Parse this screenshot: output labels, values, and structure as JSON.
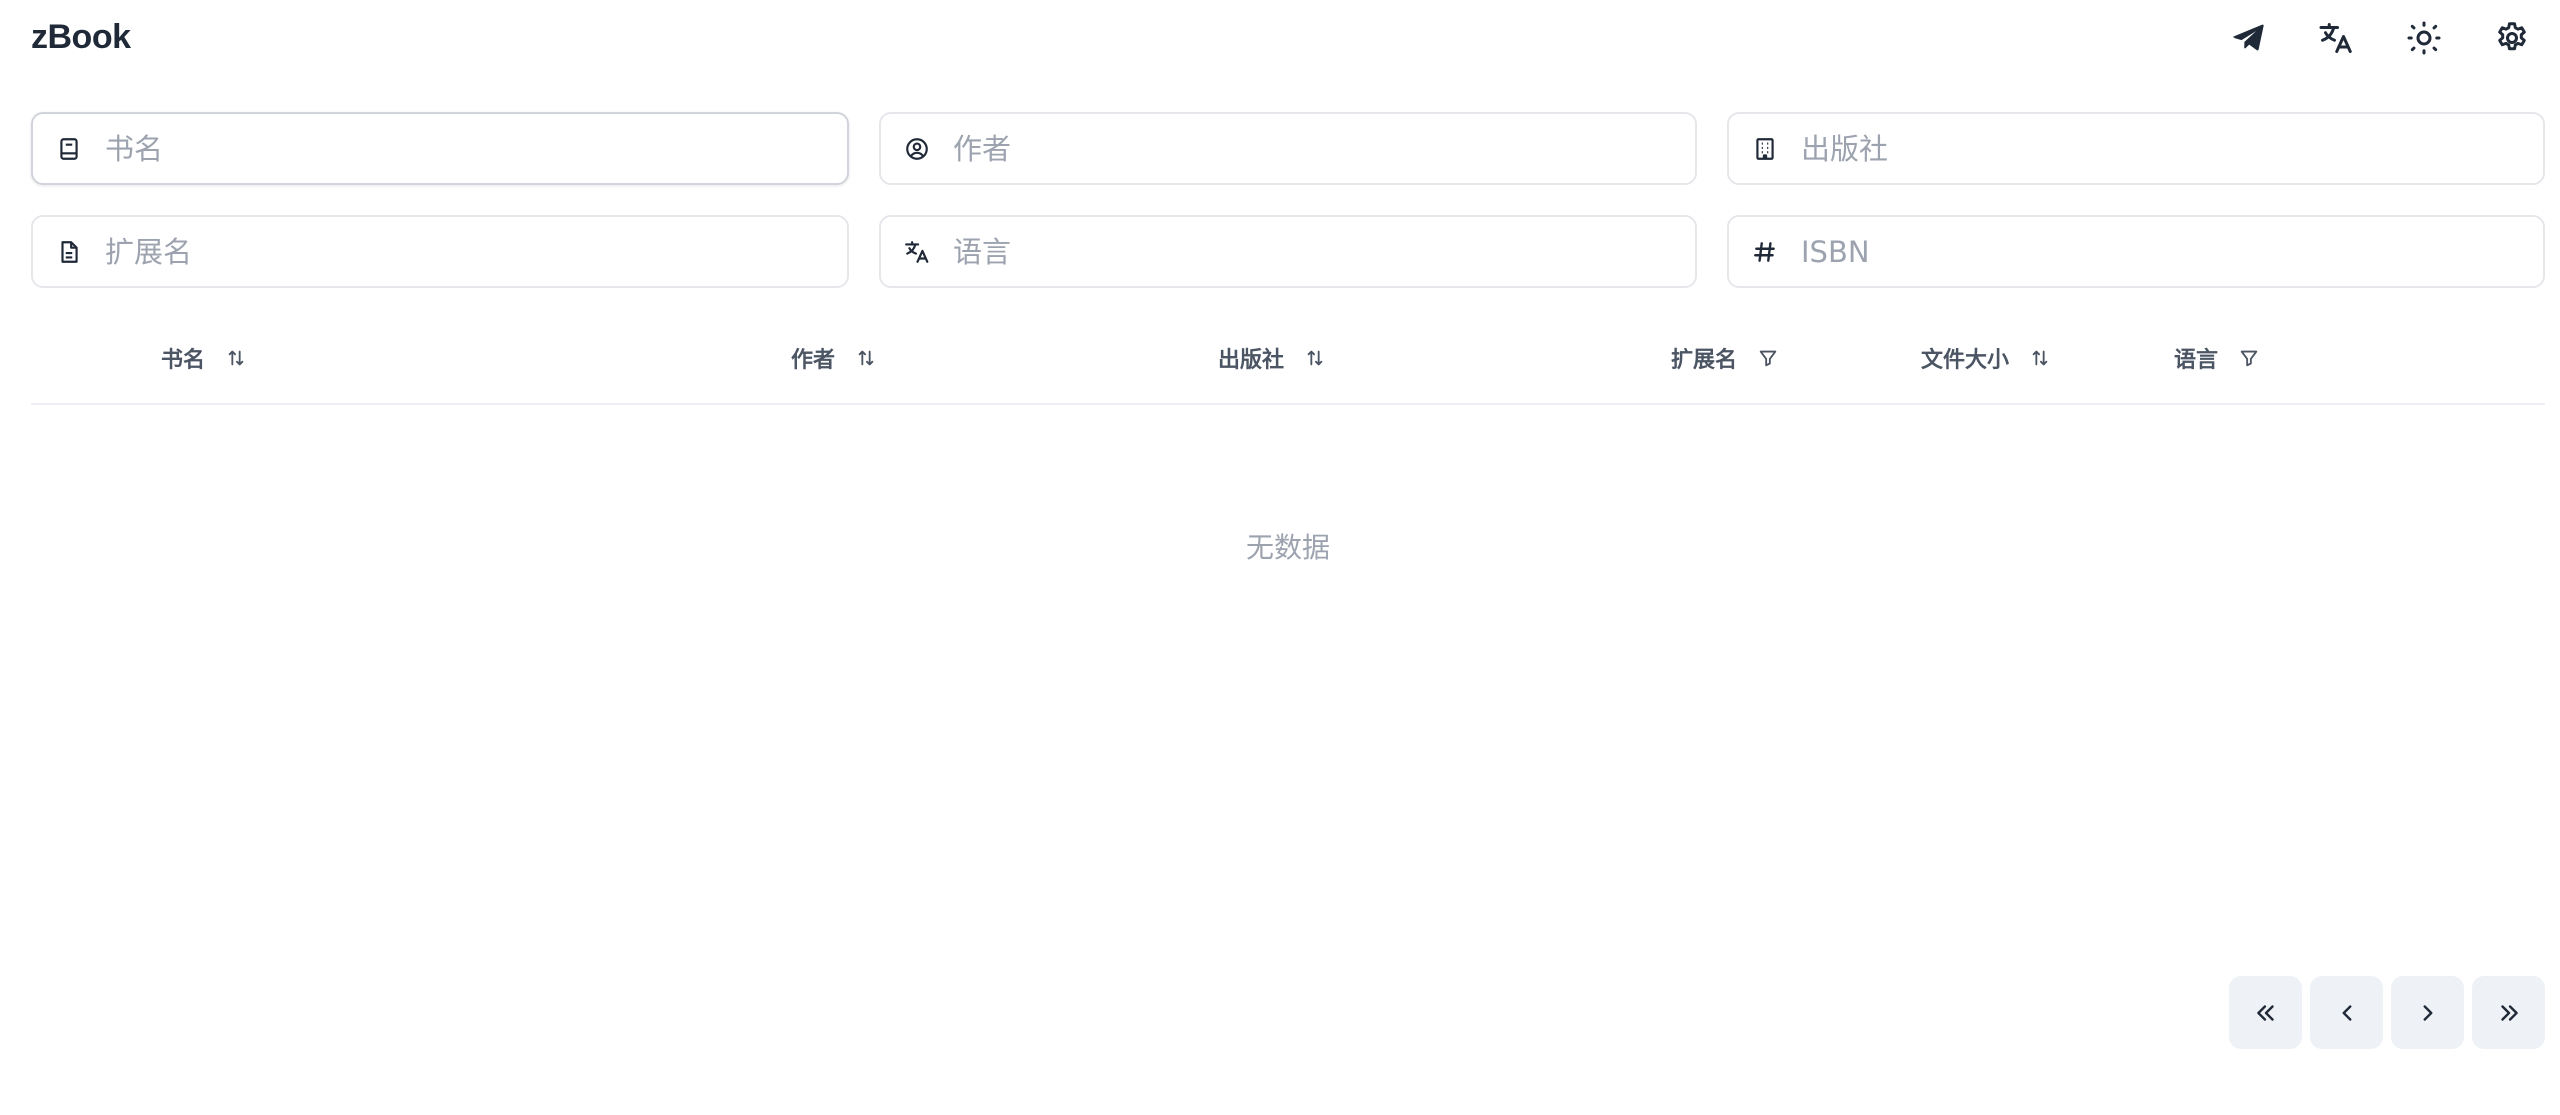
{
  "app": {
    "title": "zBook"
  },
  "header": {
    "actions": [
      "telegram-icon",
      "translate-icon",
      "sun-icon",
      "gear-icon"
    ]
  },
  "filters": {
    "title_placeholder": "书名",
    "author_placeholder": "作者",
    "publisher_placeholder": "出版社",
    "extension_placeholder": "扩展名",
    "language_placeholder": "语言",
    "isbn_placeholder": "ISBN"
  },
  "table": {
    "columns": [
      {
        "label": "书名",
        "control": "sort"
      },
      {
        "label": "作者",
        "control": "sort"
      },
      {
        "label": "出版社",
        "control": "sort"
      },
      {
        "label": "扩展名",
        "control": "filter"
      },
      {
        "label": "文件大小",
        "control": "sort"
      },
      {
        "label": "语言",
        "control": "filter"
      }
    ],
    "empty_text": "无数据"
  },
  "pagination": {
    "buttons": [
      "first-page",
      "previous-page",
      "next-page",
      "last-page"
    ]
  },
  "colors": {
    "text": "#1f2937",
    "muted": "#9ca3af",
    "border": "#e5e7eb",
    "pager_bg": "#eef1f6"
  }
}
